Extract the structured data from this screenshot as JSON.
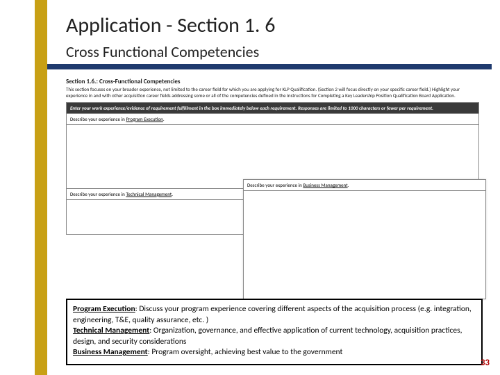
{
  "header": {
    "title": "Application - Section 1. 6",
    "subtitle": "Cross Functional Competencies"
  },
  "form": {
    "section_title": "Section 1.6.: Cross-Functional Competencies",
    "section_desc": "This section focuses on your broader experience, not limited to the career field for which you are applying for KLP Qualification. (Section 2 will focus directly on your specific career field.) Highlight your experience in and with other acquisition career fields addressing some or all of the competencies defined in the Instructions for Completing a Key Leadership Position Qualification Board Application.",
    "instruction": "Enter your work experience/evidence of requirement fulfillment in the box immediately below each requirement. Responses are limited to 1000 characters or fewer per requirement.",
    "prompt1_a": "Describe your experience in ",
    "prompt1_b": "Program Execution",
    "prompt2_a": "Describe your experience in ",
    "prompt2_b": "Technical Management",
    "overlay_a": "Describe your experience in ",
    "overlay_b": "Business Management"
  },
  "footer": {
    "pe_label": "Program Execution",
    "pe_text": ": Discuss your program experience covering different aspects of the acquisition process (e.g. integration, engineering, T&E, quality assurance, etc. )",
    "tm_label": "Technical Management",
    "tm_text": ": Organization, governance, and effective application of current technology, acquisition practices, design, and security considerations",
    "bm_label": "Business Management",
    "bm_text": ": Program oversight, achieving best value to the government"
  },
  "page": "33"
}
